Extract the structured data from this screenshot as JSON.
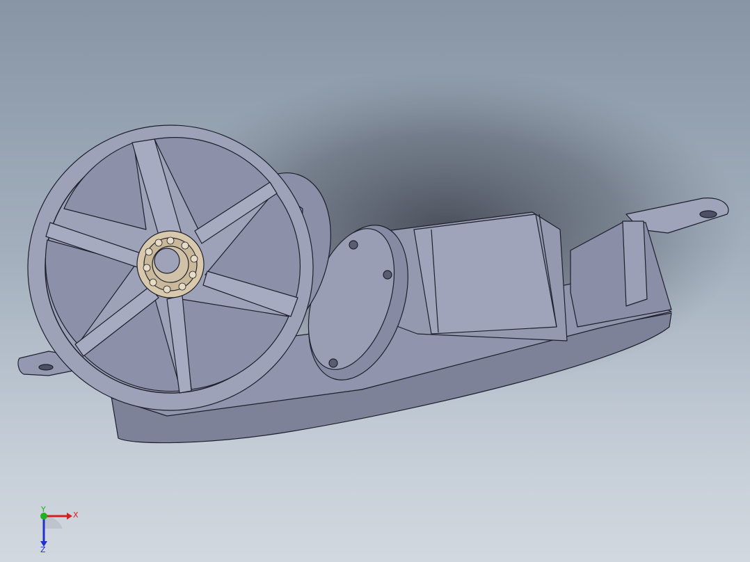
{
  "view": {
    "background_top": "#8795a5",
    "background_bottom": "#d2d8df",
    "model_color": "#8f93ab",
    "model_shadow": "#6f7390",
    "model_highlight": "#a9adc3",
    "edge_color": "#1d1f2a",
    "bearing_color": "#d8c9ad"
  },
  "triad": {
    "x_label": "X",
    "y_label": "Y",
    "z_label": "Z",
    "x_color": "#d42020",
    "y_color": "#20b020",
    "z_color": "#2030d0"
  }
}
